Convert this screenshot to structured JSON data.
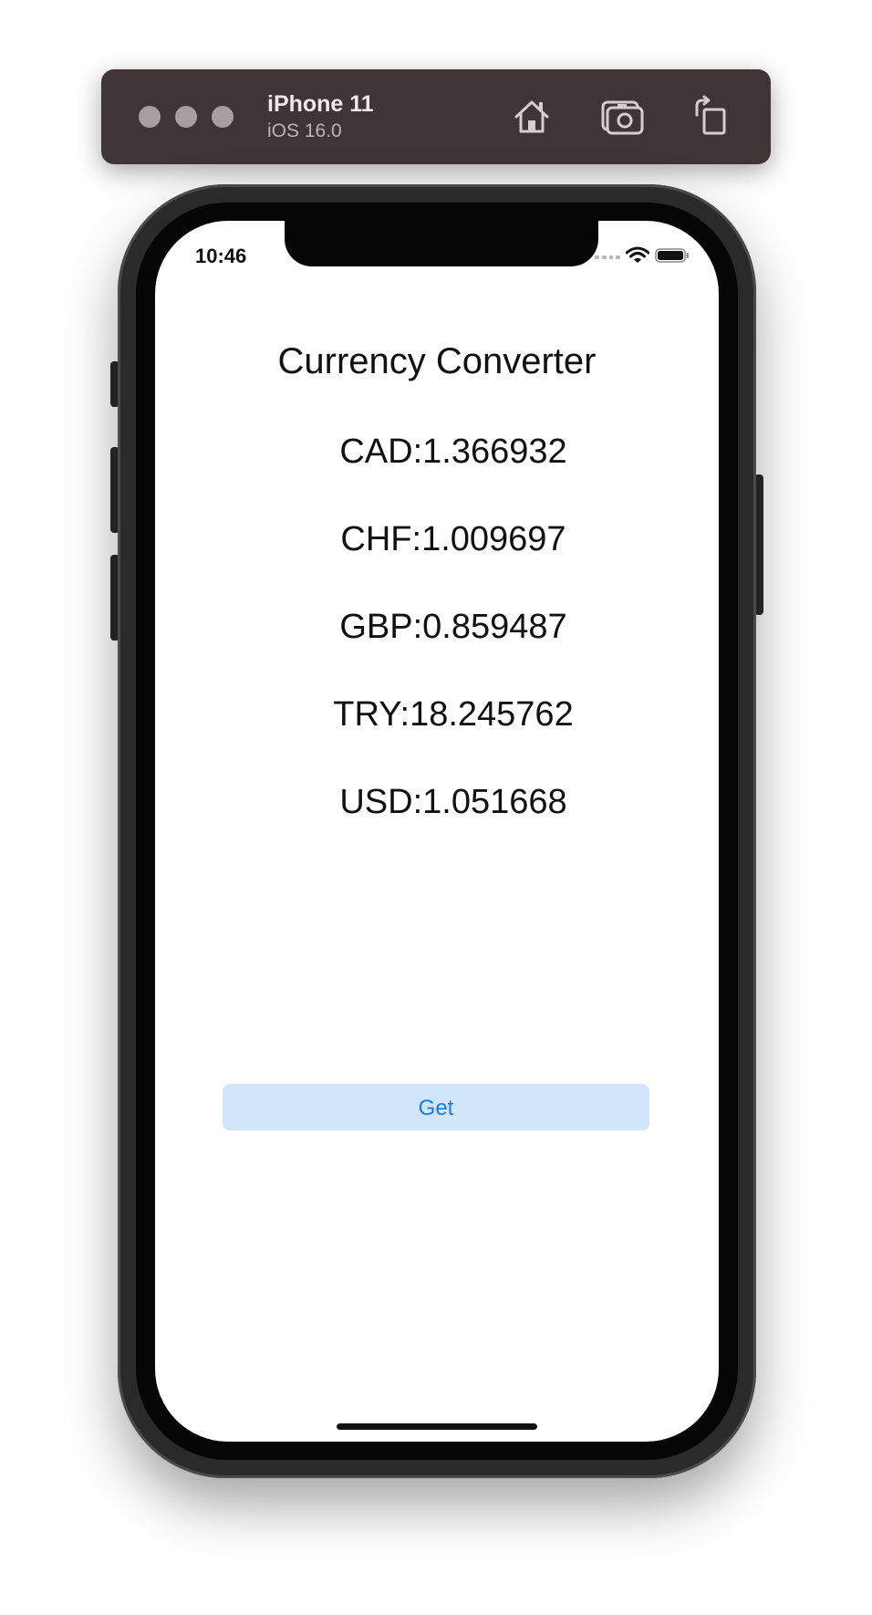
{
  "simulator": {
    "device_name": "iPhone 11",
    "os_version": "iOS 16.0",
    "toolbar_icons": [
      "home-icon",
      "screenshot-icon",
      "rotate-icon"
    ]
  },
  "status_bar": {
    "time": "10:46",
    "icons": [
      "cellular-signal-icon",
      "wifi-icon",
      "battery-icon"
    ]
  },
  "app": {
    "title": "Currency Converter",
    "rates": [
      "CAD:1.366932",
      "CHF:1.009697",
      "GBP:0.859487",
      "TRY:18.245762",
      "USD:1.051668"
    ],
    "get_button_label": "Get"
  },
  "colors": {
    "toolbar_bg": "#3f3535",
    "button_bg": "#d1e6fb",
    "button_text": "#1a7ae8"
  }
}
